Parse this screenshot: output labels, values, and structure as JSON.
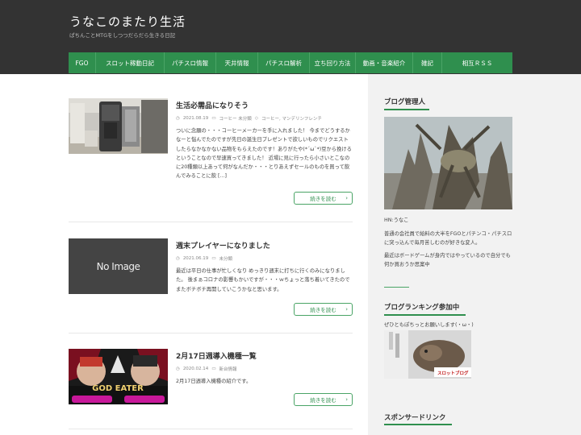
{
  "header": {
    "title": "うなこのまたり生活",
    "subtitle": "ぱちんことMTGをしつつだらだら生きる日記"
  },
  "nav": [
    {
      "label": "FGO"
    },
    {
      "label": "スロット稼動日記"
    },
    {
      "label": "パチスロ情報"
    },
    {
      "label": "天井情報"
    },
    {
      "label": "パチスロ解析"
    },
    {
      "label": "立ち回り方法"
    },
    {
      "label": "動画・音楽紹介"
    },
    {
      "label": "雑記"
    },
    {
      "label": "相互ＲＳＳ"
    }
  ],
  "articles": [
    {
      "title": "生活必需品になりそう",
      "date": "2021.08.19",
      "categories": "コーヒー 未分類",
      "tags": "コーヒー, マンデリンフレンチ",
      "excerpt": "ついに念願の・・・コーヒーメーカーを手に入れました！ 今までどうするかなーと悩んでたのですが先日の誕生日プレゼントで欲しいものでリクエストしたらなかなかない品物をもらえたのです！ありがたや(*´ω`*)豆から挽けるということなので早速買ってきました！ 近場に見に行ったら小さいとこなのに20種類以上あって何がなんだか・・・とりあえずセールのものを買って飲んでみることに飲 [...]",
      "readmore": "続きを読む"
    },
    {
      "title": "週末プレイヤーになりました",
      "date": "2021.06.19",
      "categories": "未分類",
      "tags": "",
      "thumb_text": "No Image",
      "excerpt": "最近は平日の仕事が忙しくなり めっきり週末に打ちに行くのみになりました。 後まぁコロナの影響もかいですが・・・ｗちょっと落ち着いてきたのでまたボチボチ再開していこうかなと思います。",
      "readmore": "続きを読む"
    },
    {
      "title": "2月17日週導入機種一覧",
      "date": "2020.02.14",
      "categories": "新台情報",
      "tags": "",
      "thumb_text": "GOD EATER",
      "excerpt": "2月17日週導入機種の紹介です。",
      "readmore": "続きを読む"
    }
  ],
  "sidebar": {
    "admin_title": "ブログ管理人",
    "admin_name": "HN:うなこ",
    "admin_desc1": "普通の会社員で給料の大半をFGOとパチンコ・パチスロに突っ込んで毎月苦しむのが好きな変人。",
    "admin_desc2": "最近はボードゲームが身内ではやっているので自分でも何か買おうか思案中",
    "ranking_title": "ブログランキング参加中",
    "ranking_desc": "ぜひともぽちっとお願いします(・ω・)",
    "ranking_badge": "スロットブログ",
    "sponsor_title": "スポンサードリンク"
  },
  "colors": {
    "header_bg": "#333333",
    "nav_green": "#2f8f4e",
    "sidebar_bg": "#f2f2f2"
  }
}
